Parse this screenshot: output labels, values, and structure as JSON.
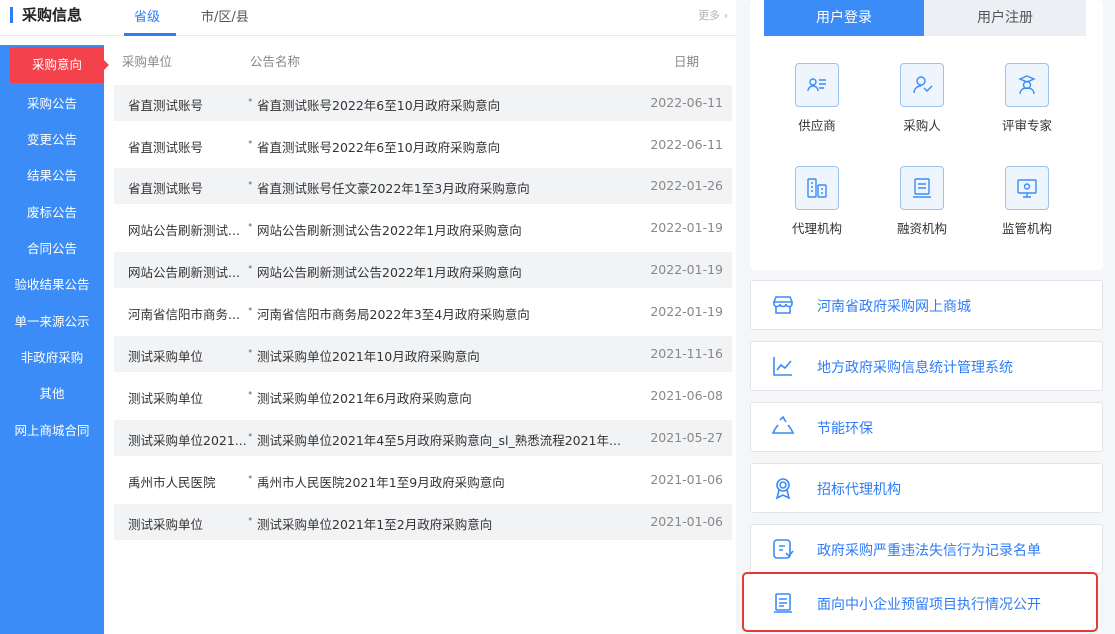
{
  "header": {
    "title": "采购信息",
    "tabs": [
      {
        "label": "省级",
        "active": true
      },
      {
        "label": "市/区/县",
        "active": false
      }
    ],
    "more_label": "更多"
  },
  "sidebar": {
    "items": [
      {
        "label": "采购意向",
        "active": true
      },
      {
        "label": "采购公告"
      },
      {
        "label": "变更公告"
      },
      {
        "label": "结果公告"
      },
      {
        "label": "废标公告"
      },
      {
        "label": "合同公告"
      },
      {
        "label": "验收结果公告"
      },
      {
        "label": "单一来源公示"
      },
      {
        "label": "非政府采购"
      },
      {
        "label": "其他"
      },
      {
        "label": "网上商城合同"
      }
    ]
  },
  "table": {
    "columns": [
      "采购单位",
      "公告名称",
      "日期"
    ],
    "rows": [
      {
        "unit": "省直测试账号",
        "title": "省直测试账号2022年6至10月政府采购意向",
        "date": "2022-06-11"
      },
      {
        "unit": "省直测试账号",
        "title": "省直测试账号2022年6至10月政府采购意向",
        "date": "2022-06-11"
      },
      {
        "unit": "省直测试账号",
        "title": "省直测试账号任文豪2022年1至3月政府采购意向",
        "date": "2022-01-26"
      },
      {
        "unit": "网站公告刷新测试...",
        "title": "网站公告刷新测试公告2022年1月政府采购意向",
        "date": "2022-01-19"
      },
      {
        "unit": "网站公告刷新测试...",
        "title": "网站公告刷新测试公告2022年1月政府采购意向",
        "date": "2022-01-19"
      },
      {
        "unit": "河南省信阳市商务...",
        "title": "河南省信阳市商务局2022年3至4月政府采购意向",
        "date": "2022-01-19"
      },
      {
        "unit": "测试采购单位",
        "title": "测试采购单位2021年10月政府采购意向",
        "date": "2021-11-16"
      },
      {
        "unit": "测试采购单位",
        "title": "测试采购单位2021年6月政府采购意向",
        "date": "2021-06-08"
      },
      {
        "unit": "测试采购单位2021...",
        "title": "测试采购单位2021年4至5月政府采购意向_sl_熟悉流程2021年...",
        "date": "2021-05-27"
      },
      {
        "unit": "禹州市人民医院",
        "title": "禹州市人民医院2021年1至9月政府采购意向",
        "date": "2021-01-06"
      },
      {
        "unit": "测试采购单位",
        "title": "测试采购单位2021年1至2月政府采购意向",
        "date": "2021-01-06"
      }
    ]
  },
  "login": {
    "tabs": [
      {
        "label": "用户登录",
        "active": true
      },
      {
        "label": "用户注册",
        "active": false
      }
    ],
    "roles": [
      {
        "label": "供应商",
        "icon": "supplier-icon"
      },
      {
        "label": "采购人",
        "icon": "purchaser-icon"
      },
      {
        "label": "评审专家",
        "icon": "expert-icon"
      },
      {
        "label": "代理机构",
        "icon": "agency-icon"
      },
      {
        "label": "融资机构",
        "icon": "finance-icon"
      },
      {
        "label": "监管机构",
        "icon": "regulator-icon"
      }
    ]
  },
  "links": [
    {
      "label": "河南省政府采购网上商城",
      "icon": "store-icon"
    },
    {
      "label": "地方政府采购信息统计管理系统",
      "icon": "chart-icon"
    },
    {
      "label": "节能环保",
      "icon": "recycle-icon"
    },
    {
      "label": "招标代理机构",
      "icon": "award-icon"
    },
    {
      "label": "政府采购严重违法失信行为记录名单",
      "icon": "credit-icon"
    },
    {
      "label": "面向中小企业预留项目执行情况公开",
      "icon": "document-icon",
      "highlighted": true
    }
  ],
  "colors": {
    "primary": "#3b8cf7",
    "active_nav": "#f3424c",
    "highlight_border": "#e53935",
    "row_shade": "#f2f3f5"
  }
}
